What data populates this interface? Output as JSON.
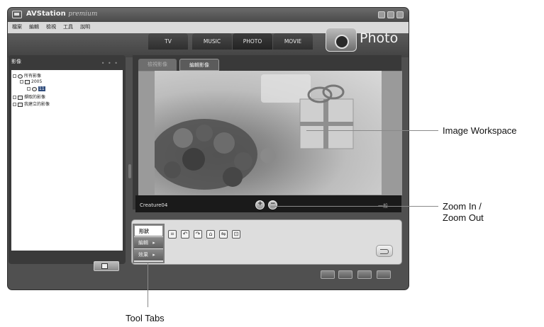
{
  "window": {
    "app_name": "AVStation",
    "app_edition": "premium",
    "mode_title": "Photo"
  },
  "menu": [
    "檔案",
    "編輯",
    "檢視",
    "工具",
    "說明"
  ],
  "mode_tabs": [
    {
      "label": "TV",
      "active": false
    },
    {
      "label": "MUSIC",
      "active": false
    },
    {
      "label": "PHOTO",
      "active": true
    },
    {
      "label": "MOVIE",
      "active": false
    }
  ],
  "sidebar": {
    "title": "影像",
    "tree": [
      {
        "label": "所有影像",
        "icon": "clock-icon"
      },
      {
        "label": "2005",
        "icon": "calendar-icon"
      },
      {
        "label": "11",
        "icon": "clock-icon",
        "selected": true
      },
      {
        "label": "擷取的影像",
        "icon": "image-icon"
      },
      {
        "label": "我建立的影像",
        "icon": "folder-icon"
      }
    ]
  },
  "panel_tabs": [
    {
      "label": "檢視影像",
      "active": false
    },
    {
      "label": "編輯影像",
      "active": true
    }
  ],
  "image": {
    "filename": "Creature04",
    "zoom_value": "一般"
  },
  "tool_tabs": [
    {
      "label": "形狀",
      "active": true
    },
    {
      "label": "編輯",
      "active": false,
      "arrow": "▸"
    },
    {
      "label": "效果",
      "active": false,
      "arrow": "▸"
    }
  ],
  "tools": [
    "crop-icon",
    "rotate-left-icon",
    "rotate-right-icon",
    "perspective-icon",
    "flip-icon",
    "resize-icon"
  ],
  "callouts": {
    "workspace": "Image Workspace",
    "zoom_line1": "Zoom In /",
    "zoom_line2": "Zoom Out",
    "tool_tabs": "Tool Tabs"
  }
}
